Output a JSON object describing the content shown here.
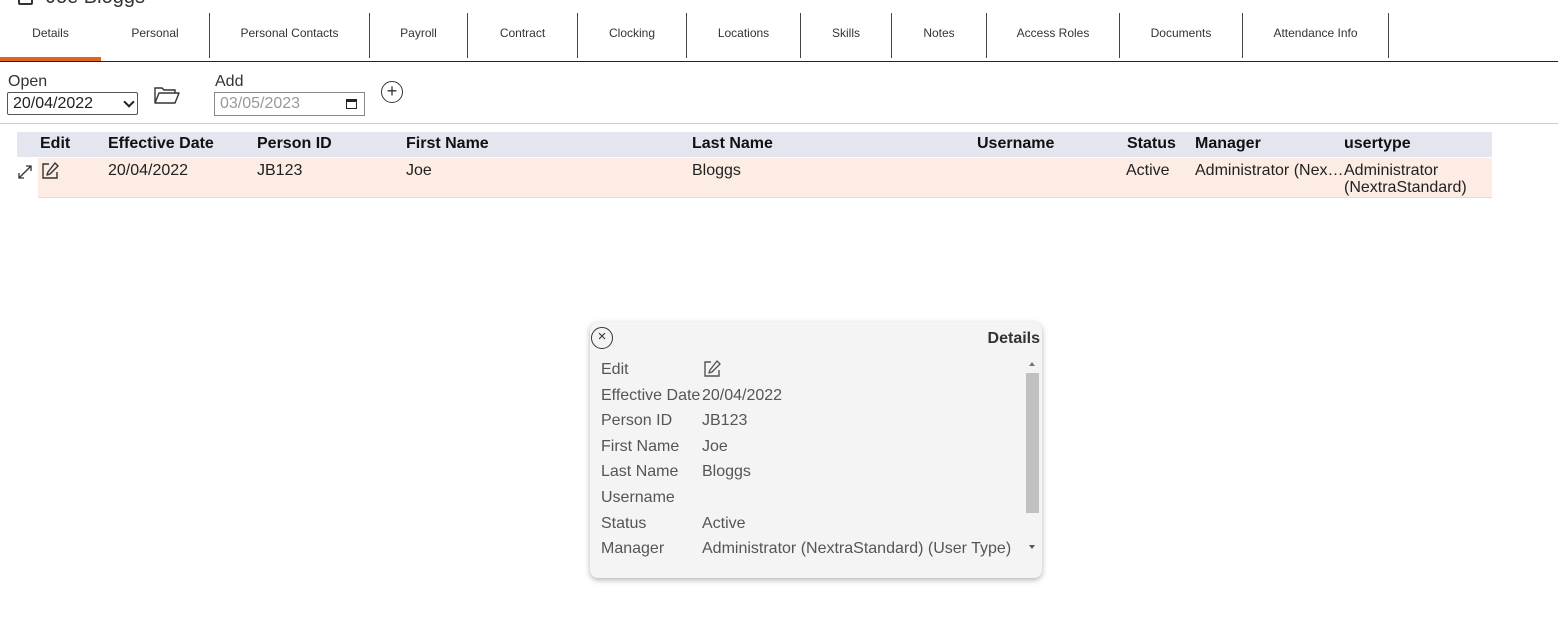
{
  "page": {
    "title": "Joe Bloggs"
  },
  "tabs": [
    {
      "label": "Details"
    },
    {
      "label": "Personal"
    },
    {
      "label": "Personal Contacts"
    },
    {
      "label": "Payroll"
    },
    {
      "label": "Contract"
    },
    {
      "label": "Clocking"
    },
    {
      "label": "Locations"
    },
    {
      "label": "Skills"
    },
    {
      "label": "Notes"
    },
    {
      "label": "Access Roles"
    },
    {
      "label": "Documents"
    },
    {
      "label": "Attendance Info"
    }
  ],
  "toolbar": {
    "open_label": "Open",
    "open_value": "20/04/2022",
    "add_label": "Add",
    "add_value": "03/05/2023"
  },
  "grid": {
    "headers": [
      "Edit",
      "Effective Date",
      "Person ID",
      "First Name",
      "Last Name",
      "Username",
      "Status",
      "Manager",
      "usertype"
    ],
    "row": {
      "effective_date": "20/04/2022",
      "person_id": "JB123",
      "first_name": "Joe",
      "last_name": "Bloggs",
      "username": "",
      "status": "Active",
      "manager": "Administrator (Nex…",
      "usertype_line1": "Administrator",
      "usertype_line2": "(NextraStandard)"
    }
  },
  "popup": {
    "title": "Details",
    "rows": [
      {
        "label": "Edit",
        "value": ""
      },
      {
        "label": "Effective Date",
        "value": "20/04/2022"
      },
      {
        "label": "Person ID",
        "value": "JB123"
      },
      {
        "label": "First Name",
        "value": "Joe"
      },
      {
        "label": "Last Name",
        "value": "Bloggs"
      },
      {
        "label": "Username",
        "value": ""
      },
      {
        "label": "Status",
        "value": "Active"
      },
      {
        "label": "Manager",
        "value": "Administrator (NextraStandard) (User Type)"
      }
    ]
  },
  "colors": {
    "active_tab": "#e0651c",
    "row_highlight": "#fcece3",
    "header_bg": "#e3e6ee"
  }
}
